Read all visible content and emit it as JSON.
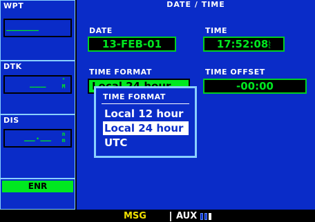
{
  "sidebar": {
    "wpt": {
      "label": "WPT",
      "value": "______"
    },
    "dtk": {
      "label": "DTK",
      "value": "___",
      "unit_top": "°",
      "unit_bottom": "M"
    },
    "dis": {
      "label": "DIS",
      "value": "__.__",
      "unit_top": "n",
      "unit_bottom": "m"
    },
    "enr": {
      "label": "ENR"
    }
  },
  "page": {
    "title": "DATE / TIME",
    "date_label": "DATE",
    "date_value": "13-FEB-01",
    "time_label": "TIME",
    "time_value": "17:52:08",
    "time_suffix": "LCL",
    "time_format_label": "TIME FORMAT",
    "time_format_value": "Local 24 hour",
    "time_offset_label": "TIME OFFSET",
    "time_offset_value": "-00:00"
  },
  "popup": {
    "title": "TIME FORMAT",
    "options": [
      "Local 12 hour",
      "Local 24 hour",
      "UTC"
    ],
    "selected_index": 1
  },
  "status_bar": {
    "msg": "MSG",
    "aux": "AUX",
    "page_count": 4,
    "active_page": 3
  },
  "colors": {
    "background": "#0a2cc8",
    "field_green": "#00e820",
    "border_light": "#8ad0ff",
    "msg_yellow": "#f0e000"
  }
}
